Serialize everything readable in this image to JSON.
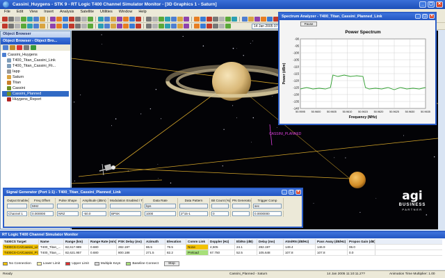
{
  "window": {
    "title": "Cassini_Huygens - STK 9 - RT Logic T400 Channel Simulator Monitor - [3D Graphics 1 - Saturn]",
    "controls": [
      "_",
      "▢",
      "✕"
    ]
  },
  "menu": {
    "items": [
      "File",
      "Edit",
      "View",
      "Insert",
      "Analysis",
      "Satellite",
      "Utilities",
      "Window",
      "Help"
    ]
  },
  "toolbar": {
    "time": "14 Jan 2005 07:09:41.2??"
  },
  "object_browser": {
    "header": "Object Browser",
    "title": "Object Browser - Object Bro...",
    "items": [
      {
        "label": "Cassini_Huygens",
        "icon": "scenario-icon",
        "color": "#4b7fd1"
      },
      {
        "label": "T400_Titan_Cassini_Link",
        "icon": "link-icon",
        "color": "#7f9db9"
      },
      {
        "label": "T400_Titan_Cassini_Fli...",
        "icon": "link-icon",
        "color": "#7f9db9"
      },
      {
        "label": "Iapp",
        "icon": "object-icon",
        "color": "#9a9a9a"
      },
      {
        "label": "Saturn",
        "icon": "planet-icon",
        "color": "#d9a441"
      },
      {
        "label": "Titan",
        "icon": "planet-icon",
        "color": "#c97f2a"
      },
      {
        "label": "Cassini",
        "icon": "satellite-icon",
        "color": "#6b8e23"
      },
      {
        "label": "Cassini_Planned",
        "icon": "satellite-icon",
        "color": "#6b8e23",
        "selected": true
      },
      {
        "label": "Huygens_Report",
        "icon": "report-icon",
        "color": "#b22222"
      }
    ]
  },
  "viewport": {
    "label": "CASSINI_PLANNED",
    "colors": {
      "line": "#d4a52a",
      "space": "#030306",
      "saturn": "#e5c58a",
      "titan": "#d8962d",
      "magenta": "#e040e0"
    }
  },
  "spectrum": {
    "title": "Spectrum Analyzer - T400_Titan_Cassini_Planned_Link",
    "button": "Pause",
    "chart_data": {
      "type": "line",
      "title": "Power Spectrum",
      "xlabel": "Frequency (MHz)",
      "ylabel": "Power (dBm)",
      "x_tick_labels": [
        "50.9595",
        "50.9600",
        "50.9605",
        "50.9610",
        "50.9615",
        "50.9620",
        "50.9625",
        "50.9630",
        "50.9635"
      ],
      "y_tick_labels": [
        "-90",
        "-95",
        "-100",
        "-105",
        "-110",
        "-115",
        "-120",
        "-125",
        "-130",
        "-135",
        "-140"
      ],
      "ylim": [
        -140,
        -90
      ],
      "grid": true,
      "series": [
        {
          "color": "#2e9e2e",
          "x": [
            0,
            0.05,
            0.1,
            0.15,
            0.2,
            0.24,
            0.26,
            0.3,
            0.35,
            0.4,
            0.45,
            0.5,
            0.52,
            0.55,
            0.6,
            0.65,
            0.7,
            0.75,
            0.8,
            0.85,
            0.9,
            0.95,
            1
          ],
          "y": [
            -126,
            -125,
            -126,
            -125.5,
            -126,
            -125,
            -116,
            -117,
            -116,
            -117,
            -116.5,
            -117,
            -125,
            -126,
            -125.5,
            -126,
            -125,
            -126.5,
            -125,
            -126,
            -125.5,
            -126,
            -125
          ]
        }
      ]
    }
  },
  "signal_generator": {
    "title": "Signal Generator (Port 1:1) - T400_Titan_Cassini_Planned_Link",
    "headers": [
      "Output Enabled",
      "Freq Offset",
      "Pulse Shape",
      "Amplitude (dBm)",
      "Modulation Enabled / Type",
      "Data Rate",
      "Data Pattern",
      "Bit Count (%)",
      "PN Generator",
      "Trigger Comp"
    ],
    "units": [
      "",
      "MHz",
      "",
      "",
      "",
      "bps",
      "",
      "",
      "",
      "sec"
    ],
    "row": [
      "Channel 1",
      "0.000000",
      "NRZ",
      "-50.0",
      "BPSK",
      "1000",
      "2^15-1",
      "0",
      "",
      "0.0000000"
    ]
  },
  "bottom": {
    "title": "RT Logic T400 Channel Simulator Monitor",
    "headers": [
      "T400CS Target",
      "Name",
      "Range (km)",
      "Range Rate (m/s)",
      "PSK Delay (ms)",
      "Azimuth",
      "Elevation",
      "Comm Link",
      "Doppler (Hz)",
      "Eb/No (dB)",
      "Delay (ms)",
      "Atm/RN (dB/Hz)",
      "Pass Away (dB/Hz)",
      "Propos Gain (dB)"
    ],
    "rows": [
      [
        "T400CS-CA/Cassini_Link",
        "T400_Titan_...",
        "82,617.989",
        "0.680",
        "282.197",
        "86.5",
        "79.5",
        "None",
        "4,505",
        "24.1",
        "282.197",
        "149.4",
        "146.9",
        "06.0"
      ],
      [
        "T400CS-CA/Cassini_Pl...",
        "T400_Titan_...",
        "82,621.957",
        "0.680",
        "800.188",
        "271.5",
        "82.2",
        "Preload",
        "67.750",
        "52.5",
        "105.648",
        "107.8",
        "107.8",
        "0.0"
      ]
    ],
    "legend": [
      "No Connection",
      "Lower Limit",
      "Upper Limit",
      "Multiple Keys",
      "Baseline Connect"
    ],
    "legend_colors": [
      "#f2c200",
      "#fff4b0",
      "#e03030",
      "#d8d8d8",
      "#a8e07a"
    ],
    "legend_button": "Stop"
  },
  "status": {
    "left": "Ready",
    "middle": "Cassini_Planned - Saturn",
    "time": "14 Jan 2005 11:10:11.2??",
    "right": "Animation Time Multiplier: 1.00"
  },
  "logo": {
    "name": "agi",
    "line1": "BUSINESS",
    "line2": "PARTNER"
  }
}
